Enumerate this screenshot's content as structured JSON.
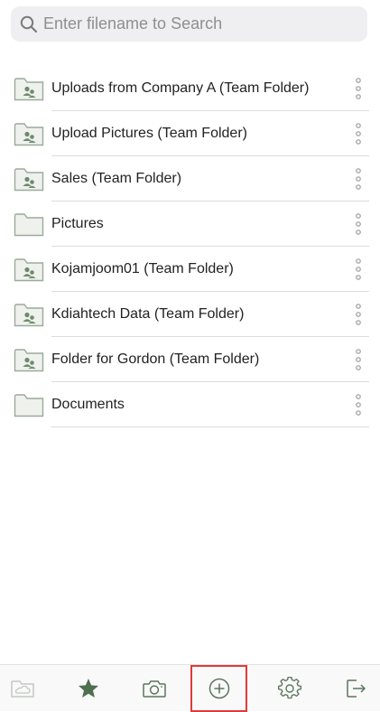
{
  "search": {
    "placeholder": "Enter filename to Search",
    "value": ""
  },
  "folders": [
    {
      "name": "Uploads from Company A (Team Folder)",
      "icon": "team-folder-icon"
    },
    {
      "name": "Upload Pictures (Team Folder)",
      "icon": "team-folder-icon"
    },
    {
      "name": "Sales (Team Folder)",
      "icon": "team-folder-icon"
    },
    {
      "name": "Pictures",
      "icon": "folder-icon"
    },
    {
      "name": "Kojamjoom01 (Team Folder)",
      "icon": "team-folder-icon"
    },
    {
      "name": "Kdiahtech Data (Team Folder)",
      "icon": "team-folder-icon"
    },
    {
      "name": "Folder for Gordon (Team Folder)",
      "icon": "team-folder-icon"
    },
    {
      "name": "Documents",
      "icon": "folder-icon"
    }
  ],
  "tabbar": {
    "tabs": [
      {
        "icon": "cloud-folder-icon"
      },
      {
        "icon": "star-icon"
      },
      {
        "icon": "camera-icon"
      },
      {
        "icon": "add-icon",
        "highlighted": true
      },
      {
        "icon": "gear-icon"
      },
      {
        "icon": "logout-icon"
      }
    ]
  },
  "colors": {
    "accent": "#4f6f4f",
    "folder_fill": "#eef1ec",
    "folder_stroke": "#9aab9a",
    "highlight": "#e03a3a"
  }
}
